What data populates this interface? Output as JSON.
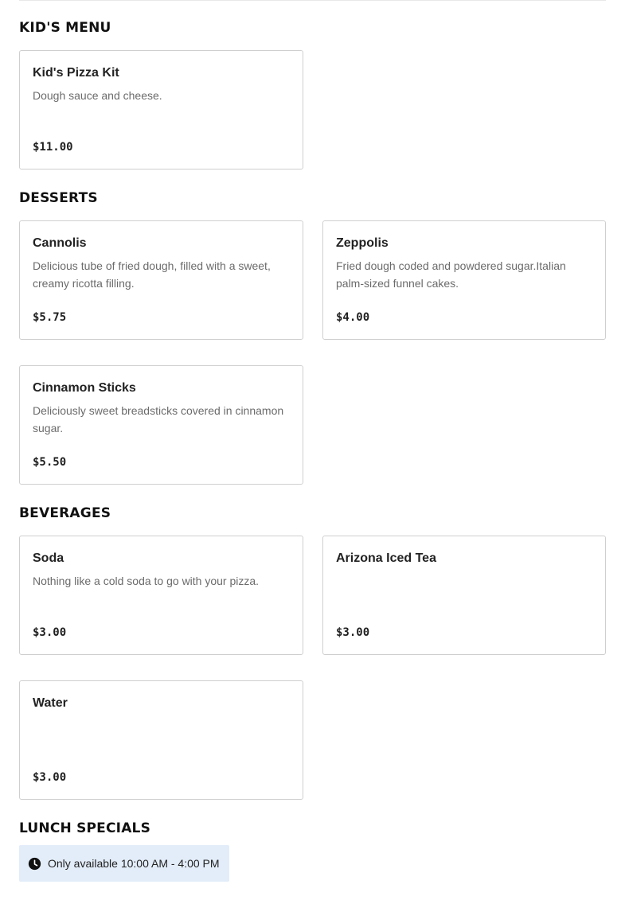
{
  "sections": [
    {
      "title": "KID'S MENU",
      "items": [
        {
          "name": "Kid's Pizza Kit",
          "description": "Dough sauce and cheese.",
          "price": "$11.00"
        }
      ]
    },
    {
      "title": "DESSERTS",
      "items": [
        {
          "name": "Cannolis",
          "description": "Delicious tube of fried dough, filled with a sweet, creamy ricotta filling.",
          "price": "$5.75"
        },
        {
          "name": "Zeppolis",
          "description": "Fried dough coded and powdered sugar.Italian palm-sized funnel cakes.",
          "price": "$4.00"
        },
        {
          "name": "Cinnamon Sticks",
          "description": "Deliciously sweet breadsticks covered in cinnamon sugar.",
          "price": "$5.50"
        }
      ]
    },
    {
      "title": "BEVERAGES",
      "items": [
        {
          "name": "Soda",
          "description": "Nothing like a cold soda to go with your pizza.",
          "price": "$3.00"
        },
        {
          "name": "Arizona Iced Tea",
          "description": "",
          "price": "$3.00"
        },
        {
          "name": "Water",
          "description": "",
          "price": "$3.00"
        }
      ]
    }
  ],
  "lunch_specials": {
    "title": "LUNCH SPECIALS",
    "availability": "Only available 10:00 AM - 4:00 PM",
    "icon": "clock-icon",
    "badge_color": "#e3edf9"
  }
}
